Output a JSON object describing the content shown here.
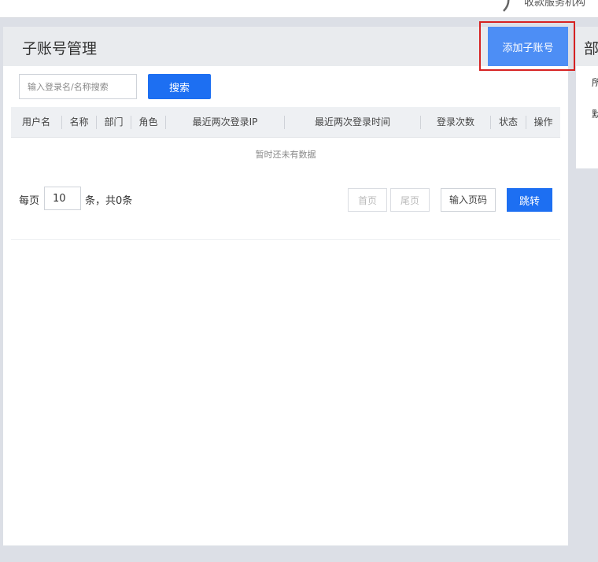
{
  "top_bar": {
    "service_text": "收款服务机构"
  },
  "header": {
    "title": "子账号管理",
    "add_button_label": "添加子账号"
  },
  "search": {
    "placeholder": "输入登录名/名称搜索",
    "value": "",
    "button_label": "搜索"
  },
  "table": {
    "columns": [
      "用户名",
      "名称",
      "部门",
      "角色",
      "最近两次登录IP",
      "最近两次登录时间",
      "登录次数",
      "状态",
      "操作"
    ],
    "empty_text": "暂时还未有数据"
  },
  "pagination": {
    "per_page_label": "每页",
    "page_size": "10",
    "count_text": "条，共0条",
    "first_label": "首页",
    "last_label": "尾页",
    "goto_placeholder": "输入页码",
    "jump_label": "跳转"
  },
  "side_panel": {
    "title": "部门",
    "line1": "所",
    "line2": "默"
  },
  "colors": {
    "primary": "#1d6ff2",
    "add_button": "#4d8ef5",
    "highlight": "#d62222",
    "header_bg": "#e9ebee",
    "page_bg": "#dcdfe6"
  }
}
